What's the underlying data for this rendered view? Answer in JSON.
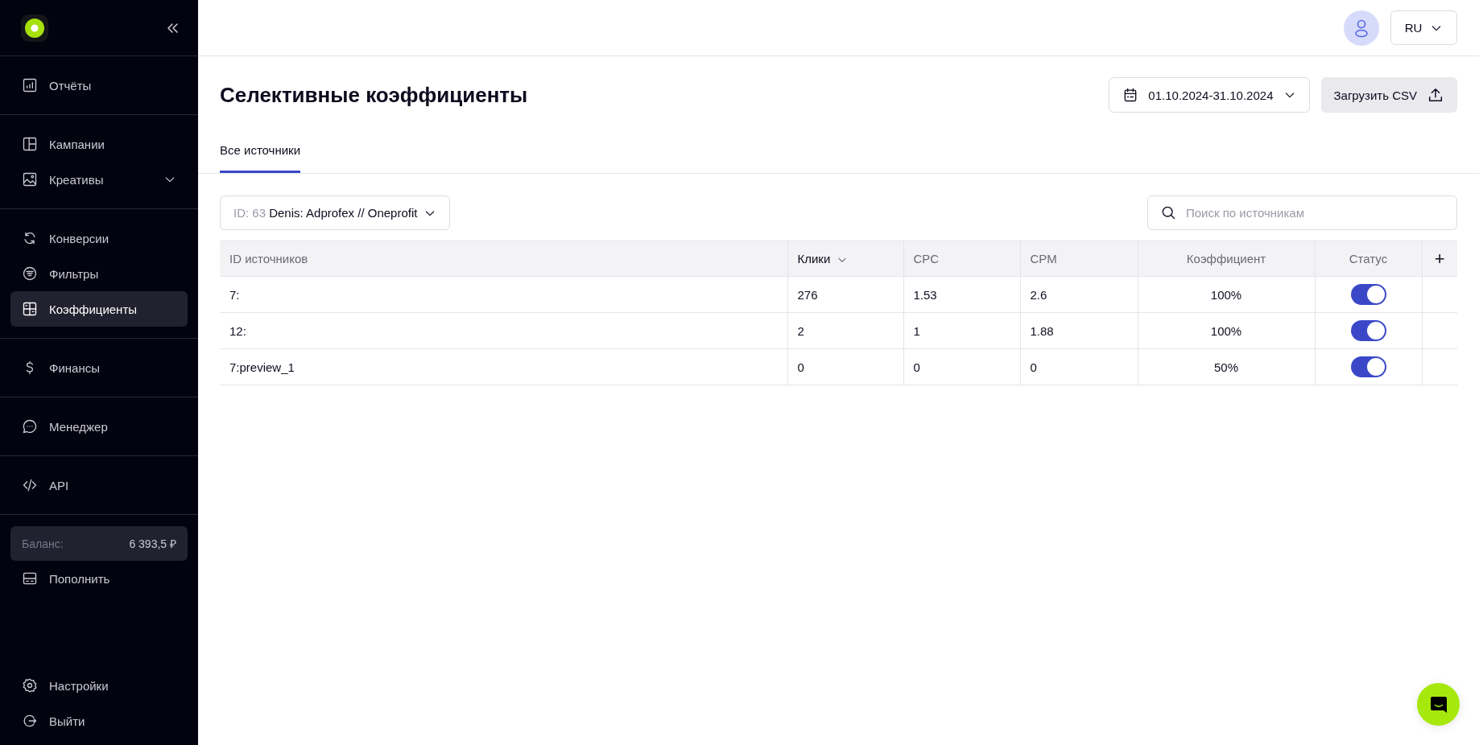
{
  "sidebar": {
    "groups": [
      [
        {
          "label": "Отчёты",
          "selected": false
        }
      ],
      [
        {
          "label": "Кампании",
          "selected": false
        },
        {
          "label": "Креативы",
          "selected": false,
          "expanded": false
        }
      ],
      [
        {
          "label": "Конверсии",
          "selected": false
        },
        {
          "label": "Фильтры",
          "selected": false
        },
        {
          "label": "Коэффициенты",
          "selected": true
        }
      ],
      [
        {
          "label": "Финансы",
          "selected": false
        }
      ],
      [
        {
          "label": "Менеджер",
          "selected": false
        }
      ],
      [
        {
          "label": "API",
          "selected": false
        }
      ]
    ],
    "balance": {
      "label": "Баланс:",
      "value": "6 393,5 ₽"
    },
    "topup": "Пополнить",
    "footer": [
      {
        "label": "Настройки"
      },
      {
        "label": "Выйти"
      }
    ]
  },
  "header": {
    "language": "RU"
  },
  "page": {
    "title": "Селективные коэффициенты",
    "date_range": "01.10.2024-31.10.2024",
    "upload_button": "Загрузить CSV",
    "tabs": [
      {
        "label": "Все источники",
        "selected": true
      }
    ],
    "campaign_select": {
      "id": "ID: 63",
      "name": "Denis: Adprofex // Oneprofit"
    },
    "search": {
      "placeholder": "Поиск по источникам"
    }
  },
  "table": {
    "columns": [
      {
        "label": "ID источников",
        "sorted": false
      },
      {
        "label": "Клики",
        "sorted": true
      },
      {
        "label": "CPC",
        "sorted": false
      },
      {
        "label": "CPM",
        "sorted": false
      },
      {
        "label": "Коэффициент",
        "sorted": false
      },
      {
        "label": "Статус",
        "sorted": false
      }
    ],
    "add_column": "+",
    "rows": [
      {
        "source": "7:",
        "clicks": "276",
        "cpc": "1.53",
        "cpm": "2.6",
        "coefficient": "100%",
        "on": true
      },
      {
        "source": "12:",
        "clicks": "2",
        "cpc": "1",
        "cpm": "1.88",
        "coefficient": "100%",
        "on": true
      },
      {
        "source": "7:preview_1",
        "clicks": "0",
        "cpc": "0",
        "cpm": "0",
        "coefficient": "50%",
        "on": true
      }
    ]
  }
}
